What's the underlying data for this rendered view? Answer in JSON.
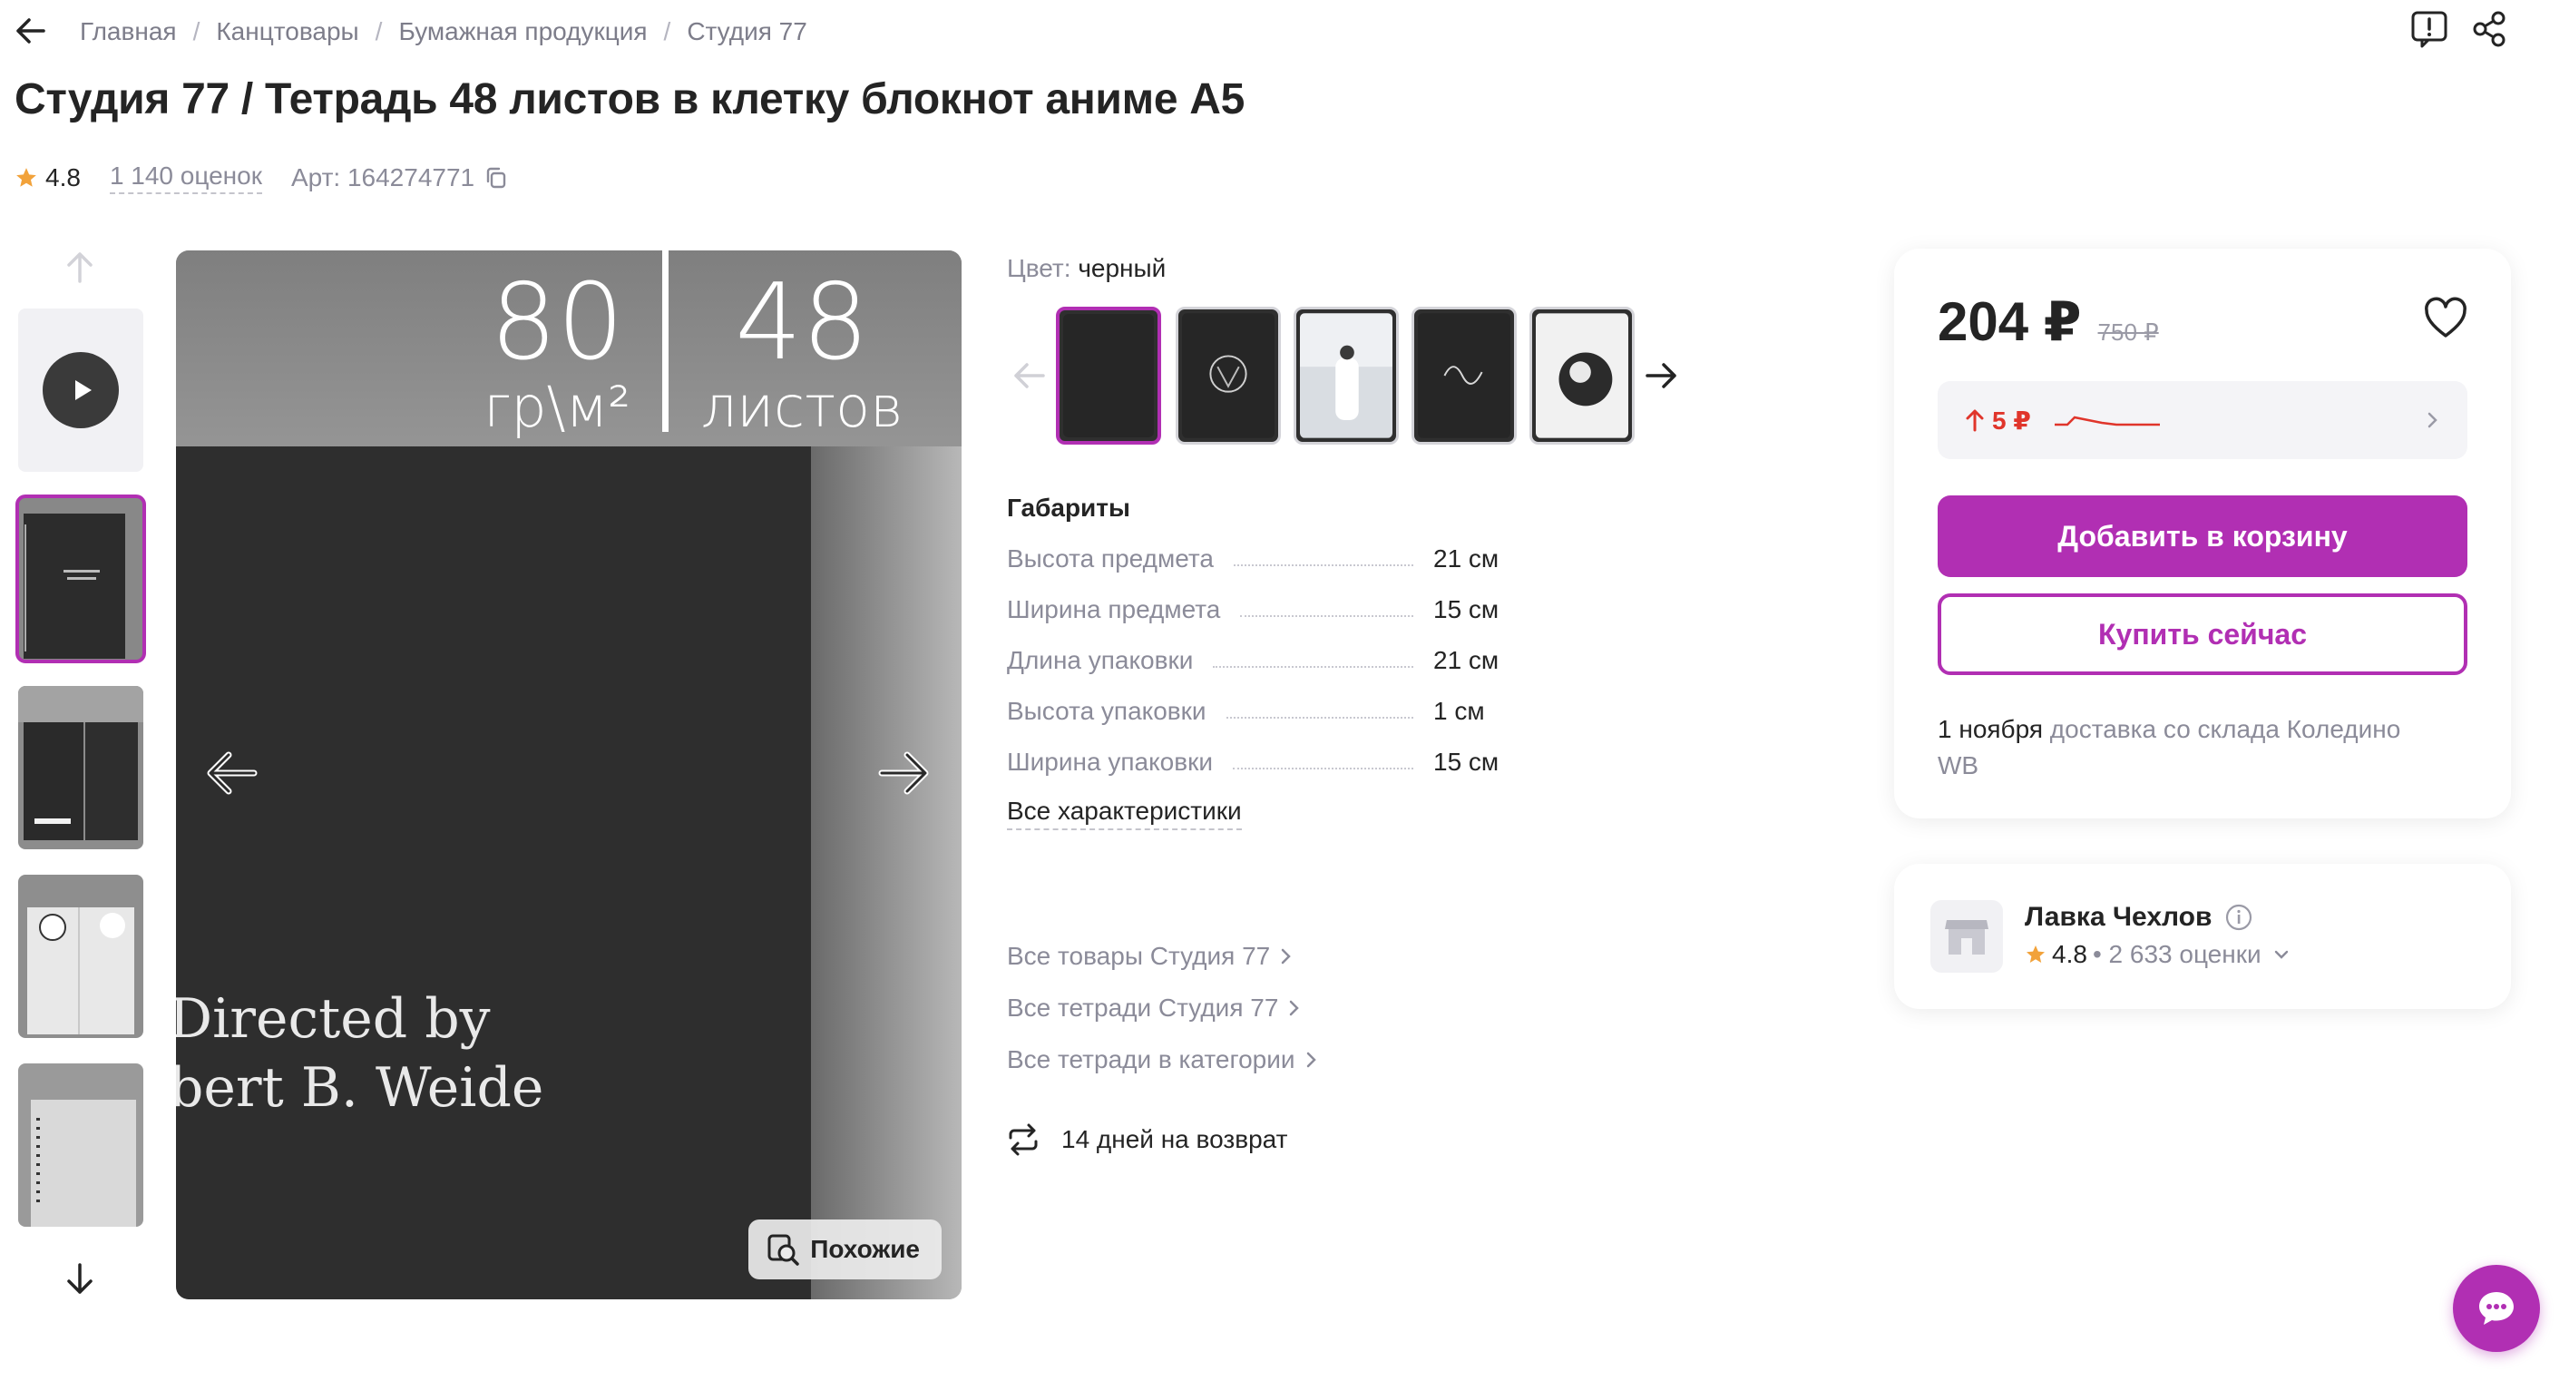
{
  "breadcrumbs": [
    "Главная",
    "Канцтовары",
    "Бумажная продукция",
    "Студия 77"
  ],
  "product": {
    "title": "Студия 77 / Тетрадь 48 листов в клетку блокнот аниме А5",
    "rating": "4.8",
    "reviews": "1 140 оценок",
    "article": "Арт: 164274771"
  },
  "gallery": {
    "image_text_top_left_value": "80",
    "image_text_top_left_unit": "гр\\м²",
    "image_text_top_right_value": "48",
    "image_text_top_right_unit": "листов",
    "image_text_line1": "Directed by",
    "image_text_line2": "bert B. Weide",
    "similar_label": "Похожие"
  },
  "color": {
    "label": "Цвет:",
    "value": "черный"
  },
  "dimensions": {
    "title": "Габариты",
    "rows": [
      {
        "key": "Высота предмета",
        "value": "21 см"
      },
      {
        "key": "Ширина предмета",
        "value": "15 см"
      },
      {
        "key": "Длина упаковки",
        "value": "21 см"
      },
      {
        "key": "Высота упаковки",
        "value": "1 см"
      },
      {
        "key": "Ширина упаковки",
        "value": "15 см"
      }
    ],
    "all_link": "Все характеристики"
  },
  "links": [
    "Все товары Студия 77",
    "Все тетради Студия 77",
    "Все тетради в категории"
  ],
  "return_policy": "14 дней на возврат",
  "price": {
    "current": "204 ₽",
    "old": "750 ₽",
    "delta": "5 ₽",
    "add_to_cart": "Добавить в корзину",
    "buy_now": "Купить сейчас",
    "delivery_date": "1 ноября",
    "delivery_rest": " доставка со склада Коледино WB"
  },
  "seller": {
    "name": "Лавка Чехлов",
    "rating": "4.8",
    "ratings_count": "• 2 633 оценки"
  },
  "colors": {
    "accent": "#b12fb3",
    "price_up": "#e0352b",
    "star": "#f2a23a"
  }
}
